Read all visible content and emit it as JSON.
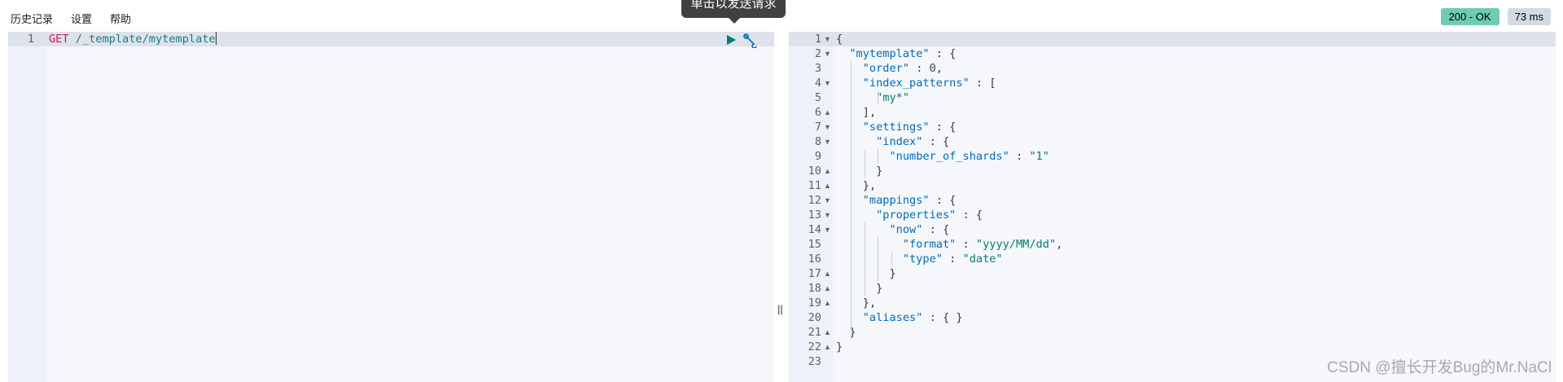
{
  "menu": {
    "history": "历史记录",
    "settings": "设置",
    "help": "帮助"
  },
  "tooltip": "单击以发送请求",
  "status": {
    "code": "200 - OK",
    "time": "73 ms"
  },
  "request": {
    "line_number": "1",
    "method": "GET",
    "path": "/_template/mytemplate"
  },
  "response": {
    "lines": [
      {
        "n": "1",
        "fold": "open",
        "text": "{"
      },
      {
        "n": "2",
        "fold": "open",
        "text": "  \"mytemplate\" : {"
      },
      {
        "n": "3",
        "fold": "",
        "text": "    \"order\" : 0,"
      },
      {
        "n": "4",
        "fold": "open",
        "text": "    \"index_patterns\" : ["
      },
      {
        "n": "5",
        "fold": "",
        "text": "      \"my*\""
      },
      {
        "n": "6",
        "fold": "close",
        "text": "    ],"
      },
      {
        "n": "7",
        "fold": "open",
        "text": "    \"settings\" : {"
      },
      {
        "n": "8",
        "fold": "open",
        "text": "      \"index\" : {"
      },
      {
        "n": "9",
        "fold": "",
        "text": "        \"number_of_shards\" : \"1\""
      },
      {
        "n": "10",
        "fold": "close",
        "text": "      }"
      },
      {
        "n": "11",
        "fold": "close",
        "text": "    },"
      },
      {
        "n": "12",
        "fold": "open",
        "text": "    \"mappings\" : {"
      },
      {
        "n": "13",
        "fold": "open",
        "text": "      \"properties\" : {"
      },
      {
        "n": "14",
        "fold": "open",
        "text": "        \"now\" : {"
      },
      {
        "n": "15",
        "fold": "",
        "text": "          \"format\" : \"yyyy/MM/dd\","
      },
      {
        "n": "16",
        "fold": "",
        "text": "          \"type\" : \"date\""
      },
      {
        "n": "17",
        "fold": "close",
        "text": "        }"
      },
      {
        "n": "18",
        "fold": "close",
        "text": "      }"
      },
      {
        "n": "19",
        "fold": "close",
        "text": "    },"
      },
      {
        "n": "20",
        "fold": "",
        "text": "    \"aliases\" : { }"
      },
      {
        "n": "21",
        "fold": "close",
        "text": "  }"
      },
      {
        "n": "22",
        "fold": "close",
        "text": "}"
      },
      {
        "n": "23",
        "fold": "",
        "text": ""
      }
    ]
  },
  "icons": {
    "run": "play-icon",
    "settings": "wrench-icon",
    "resize": "drag-handle-icon"
  },
  "colors": {
    "status_ok": "#6dccb1",
    "method": "#c6166b",
    "key": "#006bb8",
    "string": "#017d73"
  },
  "watermark": "CSDN @擅长开发Bug的Mr.NaCl"
}
